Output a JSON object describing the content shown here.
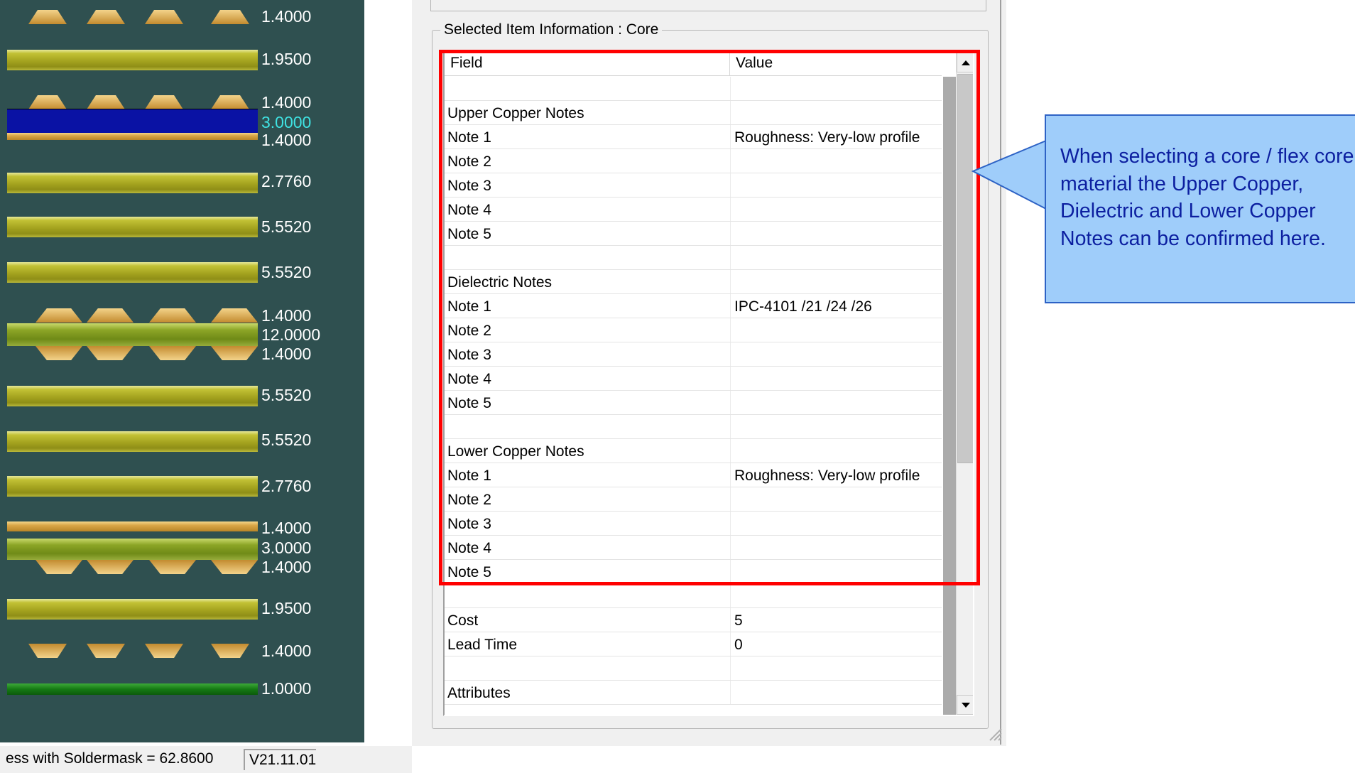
{
  "stackup": {
    "thickness_labels": [
      "1.4000",
      "1.9500",
      "1.4000",
      "3.0000",
      "1.4000",
      "2.7760",
      "5.5520",
      "5.5520",
      "1.4000",
      "12.0000",
      "1.4000",
      "5.5520",
      "5.5520",
      "2.7760",
      "1.4000",
      "3.0000",
      "1.4000",
      "1.9500",
      "1.4000",
      "1.0000"
    ],
    "selected_layer": "3.0000"
  },
  "status_bar": {
    "thickness_text": "ess with Soldermask = 62.8600",
    "version": "V21.11.01"
  },
  "properties": {
    "group_title": "Selected Item Information : Core",
    "columns": {
      "field": "Field",
      "value": "Value"
    },
    "rows": [
      {
        "field": "",
        "value": ""
      },
      {
        "field": "Upper Copper Notes",
        "value": ""
      },
      {
        "field": "Note 1",
        "value": "Roughness: Very-low profile"
      },
      {
        "field": "Note 2",
        "value": ""
      },
      {
        "field": "Note 3",
        "value": ""
      },
      {
        "field": "Note 4",
        "value": ""
      },
      {
        "field": "Note 5",
        "value": ""
      },
      {
        "field": "",
        "value": ""
      },
      {
        "field": "Dielectric Notes",
        "value": ""
      },
      {
        "field": "Note 1",
        "value": "IPC-4101 /21 /24 /26"
      },
      {
        "field": "Note 2",
        "value": ""
      },
      {
        "field": "Note 3",
        "value": ""
      },
      {
        "field": "Note 4",
        "value": ""
      },
      {
        "field": "Note 5",
        "value": ""
      },
      {
        "field": "",
        "value": ""
      },
      {
        "field": "Lower Copper Notes",
        "value": ""
      },
      {
        "field": "Note 1",
        "value": "Roughness: Very-low profile"
      },
      {
        "field": "Note 2",
        "value": ""
      },
      {
        "field": "Note 3",
        "value": ""
      },
      {
        "field": "Note 4",
        "value": ""
      },
      {
        "field": "Note 5",
        "value": ""
      },
      {
        "field": "",
        "value": ""
      },
      {
        "field": "Cost",
        "value": "5"
      },
      {
        "field": "Lead Time",
        "value": "0"
      },
      {
        "field": "",
        "value": ""
      },
      {
        "field": "Attributes",
        "value": ""
      }
    ]
  },
  "callout": {
    "text": "When selecting a core / flex core material the Upper Copper, Dielectric and Lower Copper Notes can be confirmed here."
  },
  "colors": {
    "stack_bg": "#2f5050",
    "highlight": "#ff0000",
    "callout_bg": "#9fcdfa",
    "callout_text": "#0c1fa0",
    "selected_core": "#0a12a4"
  },
  "icons": [
    "scroll-up-arrow-icon",
    "scroll-down-arrow-icon",
    "resize-grip-icon"
  ]
}
